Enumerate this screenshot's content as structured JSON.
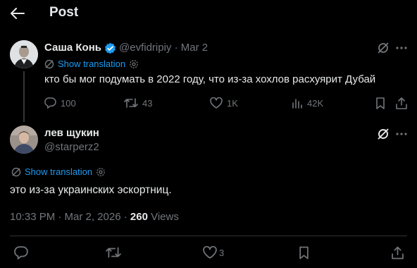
{
  "header": {
    "title": "Post"
  },
  "parent_post": {
    "author_name": "Саша Конь",
    "handle": "@evfidripiy",
    "separator": "·",
    "date": "Mar 2",
    "translate_label": "Show translation",
    "text": "кто бы мог подумать в 2022 году, что из-за хохлов расхуярит Дубай",
    "actions": {
      "replies": "100",
      "reposts": "43",
      "likes": "1K",
      "views": "42K"
    }
  },
  "main_post": {
    "author_name": "лев щукин",
    "handle": "@starperz2",
    "translate_label": "Show translation",
    "text": "это из-за украинских эскортниц.",
    "time": "10:33 PM · Mar 2, 2026 · ",
    "views_count": "260",
    "views_label": " Views",
    "actions": {
      "likes": "3"
    }
  },
  "colors": {
    "background": "#000000",
    "text": "#e7e9ea",
    "muted": "#71767b",
    "accent": "#1d9bf0",
    "divider": "#2f3336"
  },
  "icons": [
    "back-arrow-icon",
    "verified-badge-icon",
    "grok-icon",
    "more-icon",
    "translate-icon",
    "gear-icon",
    "reply-icon",
    "repost-icon",
    "like-icon",
    "views-icon",
    "bookmark-icon",
    "share-icon"
  ]
}
